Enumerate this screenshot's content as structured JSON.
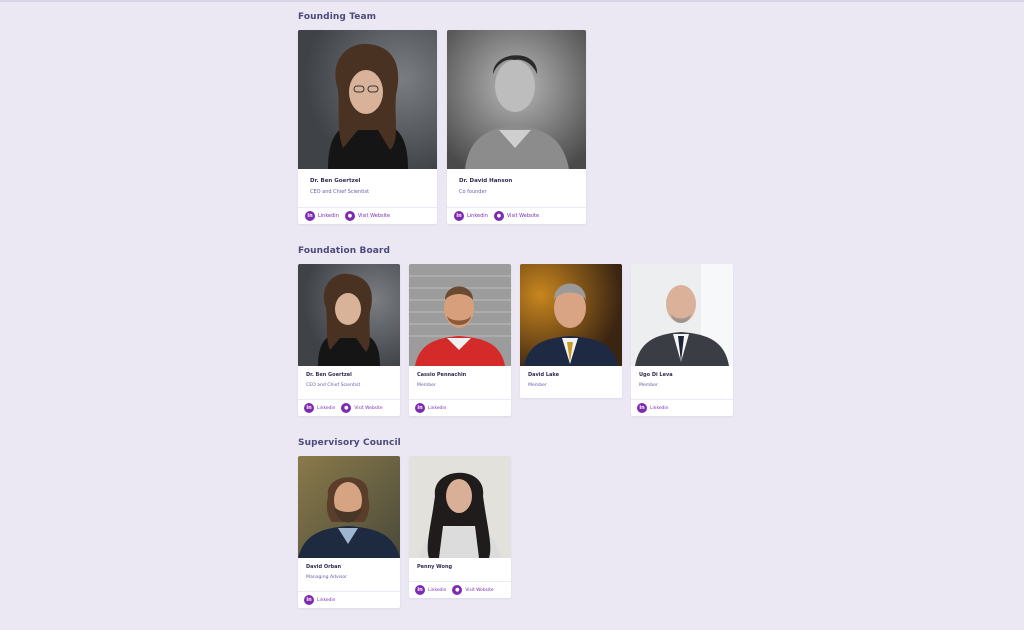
{
  "sections": [
    {
      "title": "Founding Team",
      "members": [
        {
          "name": "Dr. Ben Goertzel",
          "role": "CEO and Chief Scientist",
          "links": [
            "Linkedin",
            "Visit Website"
          ]
        },
        {
          "name": "Dr. David Hanson",
          "role": "Co founder",
          "links": [
            "Linkedin",
            "Visit Website"
          ]
        }
      ]
    },
    {
      "title": "Foundation Board",
      "members": [
        {
          "name": "Dr. Ben Goertzel",
          "role": "CEO and Chief Scientist",
          "links": [
            "Linkedin",
            "Visit Website"
          ]
        },
        {
          "name": "Cassio Pennachin",
          "role": "Member",
          "links": [
            "Linkedin"
          ]
        },
        {
          "name": "David Lake",
          "role": "Member",
          "links": []
        },
        {
          "name": "Ugo Di Leva",
          "role": "Member",
          "links": [
            "Linkedin"
          ]
        }
      ]
    },
    {
      "title": "Supervisory Council",
      "members": [
        {
          "name": "David Orban",
          "role": "Managing Advisor",
          "links": [
            "Linkedin"
          ]
        },
        {
          "name": "Penny Wong",
          "role": "",
          "links": [
            "Linkedin",
            "Visit Website"
          ]
        }
      ]
    }
  ],
  "icons": {
    "linkedin": "linkedin-icon",
    "website": "globe-icon"
  },
  "colors": {
    "background": "#ebe8f4",
    "accent": "#7d2bb0",
    "heading": "#4c4a7a"
  }
}
